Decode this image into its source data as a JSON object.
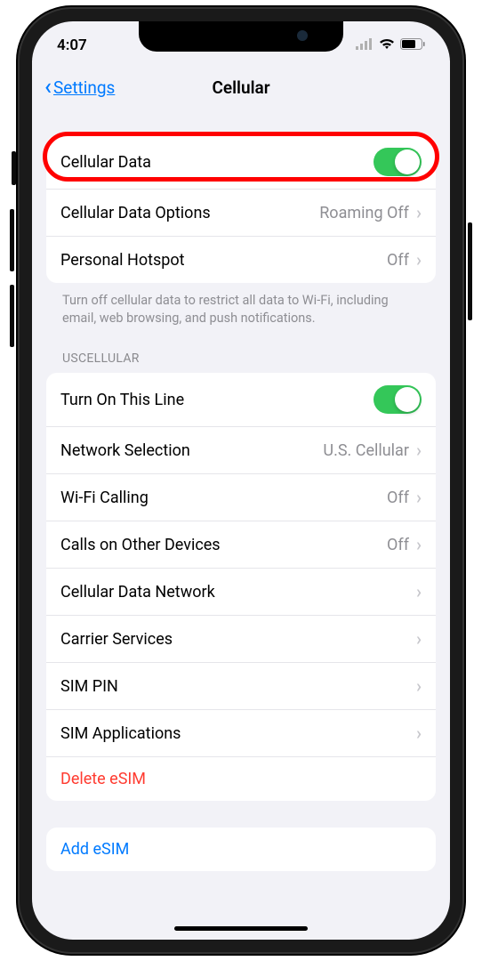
{
  "status": {
    "time": "4:07"
  },
  "nav": {
    "back": "Settings",
    "title": "Cellular"
  },
  "section1": {
    "cellular_data": "Cellular Data",
    "cellular_data_options": "Cellular Data Options",
    "cellular_data_options_value": "Roaming Off",
    "personal_hotspot": "Personal Hotspot",
    "personal_hotspot_value": "Off",
    "footer": "Turn off cellular data to restrict all data to Wi-Fi, including email, web browsing, and push notifications."
  },
  "section2": {
    "header": "USCELLULAR",
    "turn_on_line": "Turn On This Line",
    "network_selection": "Network Selection",
    "network_selection_value": "U.S. Cellular",
    "wifi_calling": "Wi-Fi Calling",
    "wifi_calling_value": "Off",
    "calls_other": "Calls on Other Devices",
    "calls_other_value": "Off",
    "cellular_network": "Cellular Data Network",
    "carrier_services": "Carrier Services",
    "sim_pin": "SIM PIN",
    "sim_apps": "SIM Applications",
    "delete_esim": "Delete eSIM"
  },
  "section3": {
    "add_esim": "Add eSIM"
  }
}
